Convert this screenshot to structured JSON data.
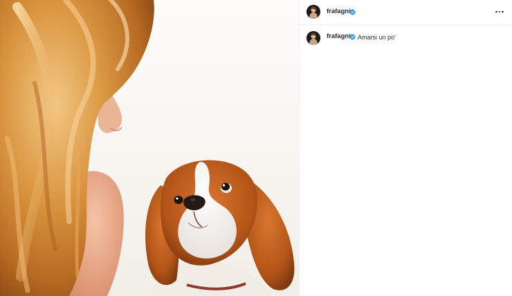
{
  "post": {
    "author": {
      "username": "frafagni",
      "verified": true,
      "avatar_icon": "profile-avatar-icon",
      "verified_icon": "verified-badge-icon"
    },
    "caption": {
      "username": "frafagni",
      "text": "Amarsi un po'"
    },
    "more_options_icon": "more-options-icon",
    "image": {
      "subject_icon": "photo-woman-and-dog"
    },
    "colors": {
      "verified_blue": "#3897f0",
      "text_primary": "#262626",
      "divider": "#efefef"
    }
  }
}
